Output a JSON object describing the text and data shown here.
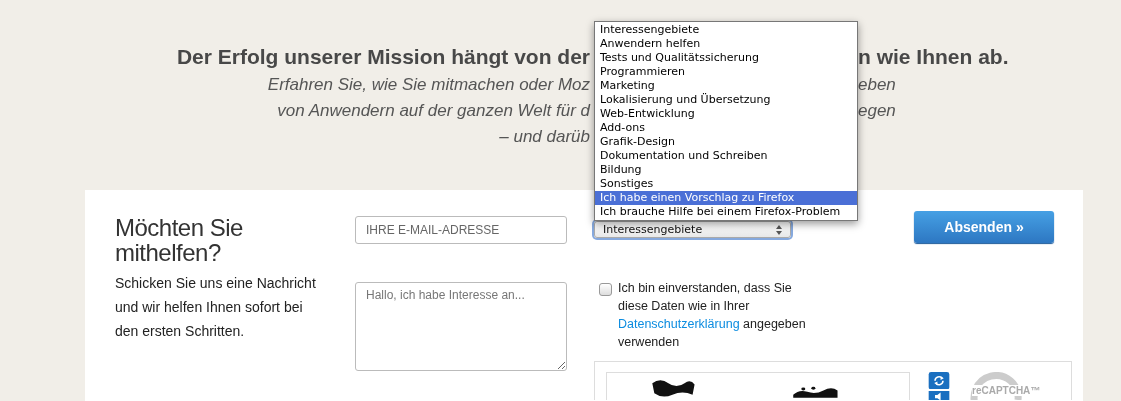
{
  "intro": {
    "heading_left": "Der Erfolg unserer Mission hängt von der",
    "heading_right": "n wie Ihnen ab.",
    "lines": [
      {
        "left": "Erfahren Sie, wie Sie mitmachen oder Moz",
        "right": "eben"
      },
      {
        "left": "von Anwendern auf der ganzen Welt für d",
        "right": "egen"
      },
      {
        "left": "– und darüb"
      }
    ]
  },
  "form": {
    "title": "Möchten Sie mithelfen?",
    "description": "Schicken Sie uns eine Nachricht und wir helfen Ihnen sofort bei den ersten Schritten.",
    "email": {
      "placeholder": "IHRE E-MAIL-ADRESSE"
    },
    "message": {
      "placeholder": "Hallo, ich habe Interesse an..."
    },
    "interest_select": {
      "value": "Interessengebiete",
      "focused": true,
      "expanded": true,
      "options": [
        {
          "label": "Interessengebiete",
          "highlighted": false
        },
        {
          "label": "Anwendern helfen",
          "highlighted": false
        },
        {
          "label": "Tests und Qualitätssicherung",
          "highlighted": false
        },
        {
          "label": "Programmieren",
          "highlighted": false
        },
        {
          "label": "Marketing",
          "highlighted": false
        },
        {
          "label": "Lokalisierung und Übersetzung",
          "highlighted": false
        },
        {
          "label": "Web-Entwicklung",
          "highlighted": false
        },
        {
          "label": "Add-ons",
          "highlighted": false
        },
        {
          "label": "Grafik-Design",
          "highlighted": false
        },
        {
          "label": "Dokumentation und Schreiben",
          "highlighted": false
        },
        {
          "label": "Bildung",
          "highlighted": false
        },
        {
          "label": "Sonstiges",
          "highlighted": false
        },
        {
          "label": "Ich habe einen Vorschlag zu Firefox",
          "highlighted": true
        },
        {
          "label": "Ich brauche Hilfe bei einem Firefox-Problem",
          "highlighted": false
        }
      ]
    },
    "consent": {
      "checked": false,
      "before": "Ich bin einverstanden, dass Sie diese Daten wie in Ihrer",
      "link": "Datenschutzerklärung",
      "after": "angegeben verwenden"
    },
    "captcha": {
      "logo_text": "reCAPTCHA™"
    },
    "submit": "Absenden »"
  }
}
